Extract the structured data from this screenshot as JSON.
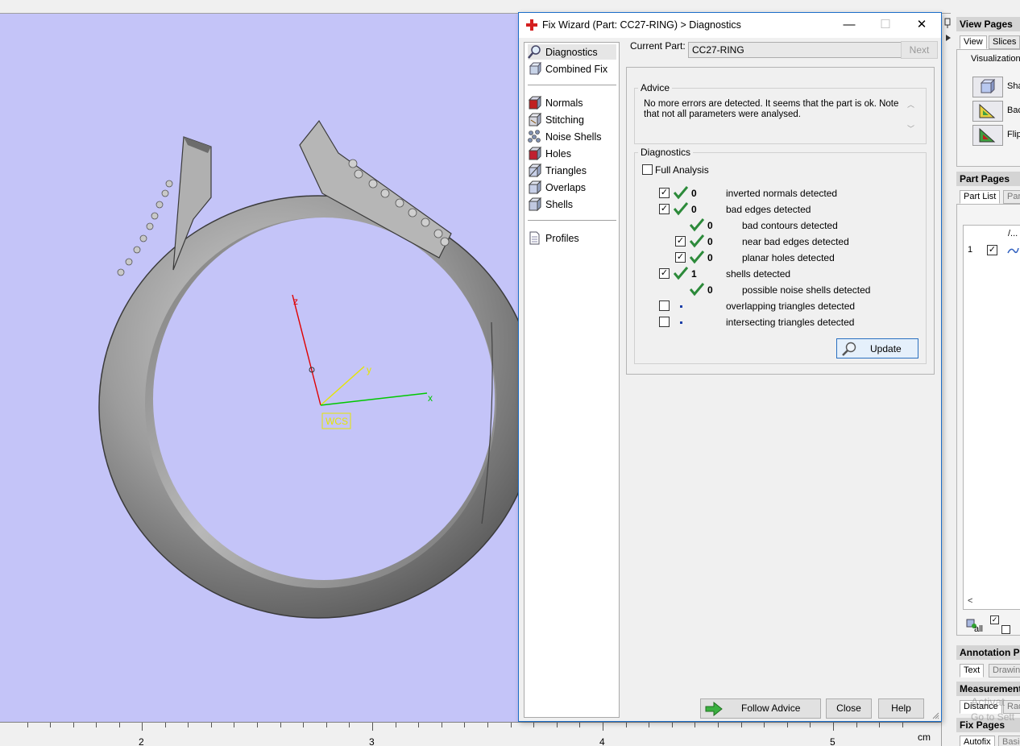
{
  "viewport": {
    "axis_z": "z",
    "axis_y": "y",
    "axis_x": "x",
    "wcs_label": "WCS",
    "ruler": {
      "labels": [
        "2",
        "3",
        "4",
        "5"
      ],
      "unit": "cm"
    }
  },
  "right_panel": {
    "view_pages": {
      "title": "View Pages",
      "tabs": [
        "View",
        "Slices"
      ],
      "group": "Visualization",
      "items": [
        "Sha",
        "Bac",
        "Flip"
      ]
    },
    "part_pages": {
      "title": "Part Pages",
      "tabs": [
        "Part List",
        "Part"
      ],
      "col_header": "/...",
      "row_index": "1",
      "all_label": "all"
    },
    "annotation_pages": {
      "title": "Annotation Pa",
      "tabs": [
        "Text",
        "Drawing"
      ]
    },
    "measurement_pages": {
      "title": "Measurement",
      "tabs": [
        "Distance",
        "Rad"
      ]
    },
    "fix_pages": {
      "title": "Fix Pages",
      "tabs": [
        "Autofix",
        "Basic"
      ]
    },
    "watermark": [
      "Activat",
      "Go to Sett"
    ]
  },
  "dialog": {
    "title": "Fix Wizard (Part: CC27-RING) > Diagnostics",
    "window_buttons": {
      "minimize": "—",
      "maximize": "☐",
      "close": "✕"
    },
    "nav": {
      "top": [
        {
          "label": "Diagnostics",
          "icon": "magnifier-icon",
          "selected": true
        },
        {
          "label": "Combined Fix",
          "icon": "combined-fix-icon",
          "selected": false
        }
      ],
      "tools": [
        {
          "label": "Normals",
          "icon": "normals-icon"
        },
        {
          "label": "Stitching",
          "icon": "stitching-icon"
        },
        {
          "label": "Noise Shells",
          "icon": "noise-shells-icon"
        },
        {
          "label": "Holes",
          "icon": "holes-icon"
        },
        {
          "label": "Triangles",
          "icon": "triangles-icon"
        },
        {
          "label": "Overlaps",
          "icon": "overlaps-icon"
        },
        {
          "label": "Shells",
          "icon": "shells-icon"
        }
      ],
      "bottom": [
        {
          "label": "Profiles",
          "icon": "profiles-icon"
        }
      ]
    },
    "current_part": {
      "label": "Current Part:",
      "value": "CC27-RING",
      "next_label": "Next"
    },
    "advice": {
      "legend": "Advice",
      "text": "No more errors are detected. It seems that the part is ok. Note that not all parameters were analysed."
    },
    "diagnostics": {
      "legend": "Diagnostics",
      "full_analysis": {
        "label": "Full Analysis",
        "checked": false
      },
      "rows": [
        {
          "count": "0",
          "label": "inverted normals detected",
          "checkbox": true,
          "checked": true,
          "status": "ok",
          "indent": 0
        },
        {
          "count": "0",
          "label": "bad edges detected",
          "checkbox": true,
          "checked": true,
          "status": "ok",
          "indent": 0
        },
        {
          "count": "0",
          "label": "bad contours detected",
          "checkbox": false,
          "checked": false,
          "status": "ok",
          "indent": 1
        },
        {
          "count": "0",
          "label": "near bad edges detected",
          "checkbox": true,
          "checked": true,
          "status": "ok",
          "indent": 1
        },
        {
          "count": "0",
          "label": "planar holes detected",
          "checkbox": true,
          "checked": true,
          "status": "ok",
          "indent": 1
        },
        {
          "count": "1",
          "label": "shells detected",
          "checkbox": true,
          "checked": true,
          "status": "ok",
          "indent": 0
        },
        {
          "count": "0",
          "label": "possible noise shells detected",
          "checkbox": false,
          "checked": false,
          "status": "ok",
          "indent": 1
        },
        {
          "count": "",
          "label": "overlapping triangles detected",
          "checkbox": true,
          "checked": false,
          "status": "pending",
          "indent": 0
        },
        {
          "count": "",
          "label": "intersecting triangles detected",
          "checkbox": true,
          "checked": false,
          "status": "pending",
          "indent": 0
        }
      ],
      "update_label": "Update"
    },
    "buttons": {
      "follow_advice": "Follow Advice",
      "close": "Close",
      "help": "Help"
    },
    "colors": {
      "accent": "#1c6ec9",
      "check_green": "#2c8a3a"
    }
  }
}
